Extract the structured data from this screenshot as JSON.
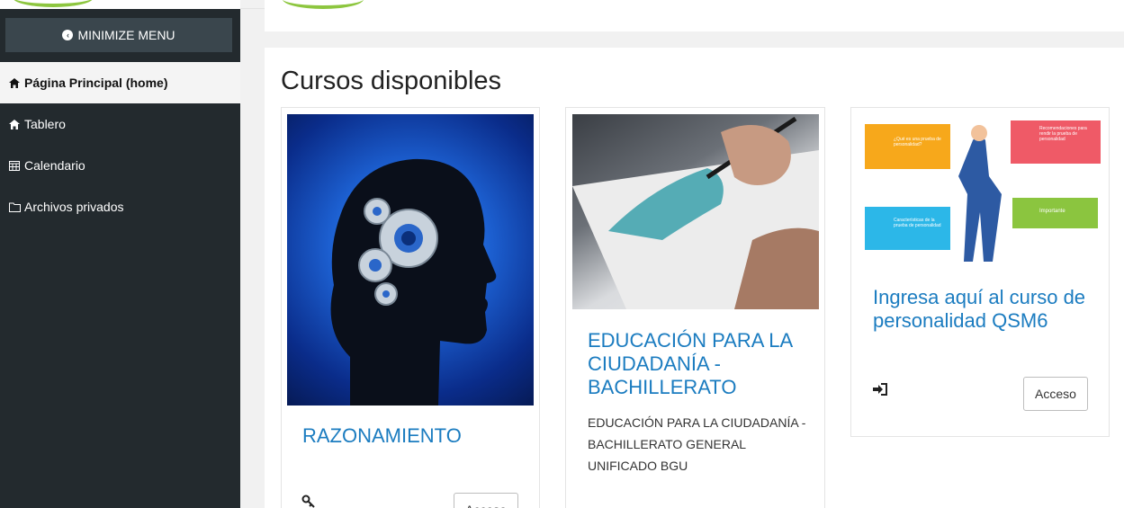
{
  "sidebar": {
    "minimize_label": "MINIMIZE MENU",
    "items": [
      {
        "label": "Página Principal (home)",
        "icon": "home-icon",
        "active": true
      },
      {
        "label": "Tablero",
        "icon": "home-icon",
        "active": false
      },
      {
        "label": "Calendario",
        "icon": "calendar-icon",
        "active": false
      },
      {
        "label": "Archivos privados",
        "icon": "folder-icon",
        "active": false
      }
    ]
  },
  "main": {
    "heading": "Cursos disponibles",
    "courses": [
      {
        "title": "RAZONAMIENTO",
        "description": "",
        "access_label": "Acceso",
        "image": "head-with-gears"
      },
      {
        "title": "EDUCACIÓN PARA LA CIUDADANÍA - BACHILLERATO",
        "description": "EDUCACIÓN PARA LA CIUDADANÍA - BACHILLERATO GENERAL UNIFICADO BGU",
        "access_label": "",
        "image": "hand-painting-watercolor"
      },
      {
        "title": "Ingresa aquí al curso de personalidad QSM6",
        "description": "",
        "access_label": "Acceso",
        "image": "personality-test-infographic",
        "infographic": {
          "box1": "¿Qué es una prueba de personalidad?",
          "box2": "Recomendaciones para rendir la prueba de personalidad",
          "box3": "Características de la prueba de personalidad",
          "box4": "Importante"
        }
      }
    ]
  },
  "colors": {
    "sidebar_bg": "#232a2e",
    "link_blue": "#1b7cc0",
    "accent_green": "#8dc63f"
  }
}
